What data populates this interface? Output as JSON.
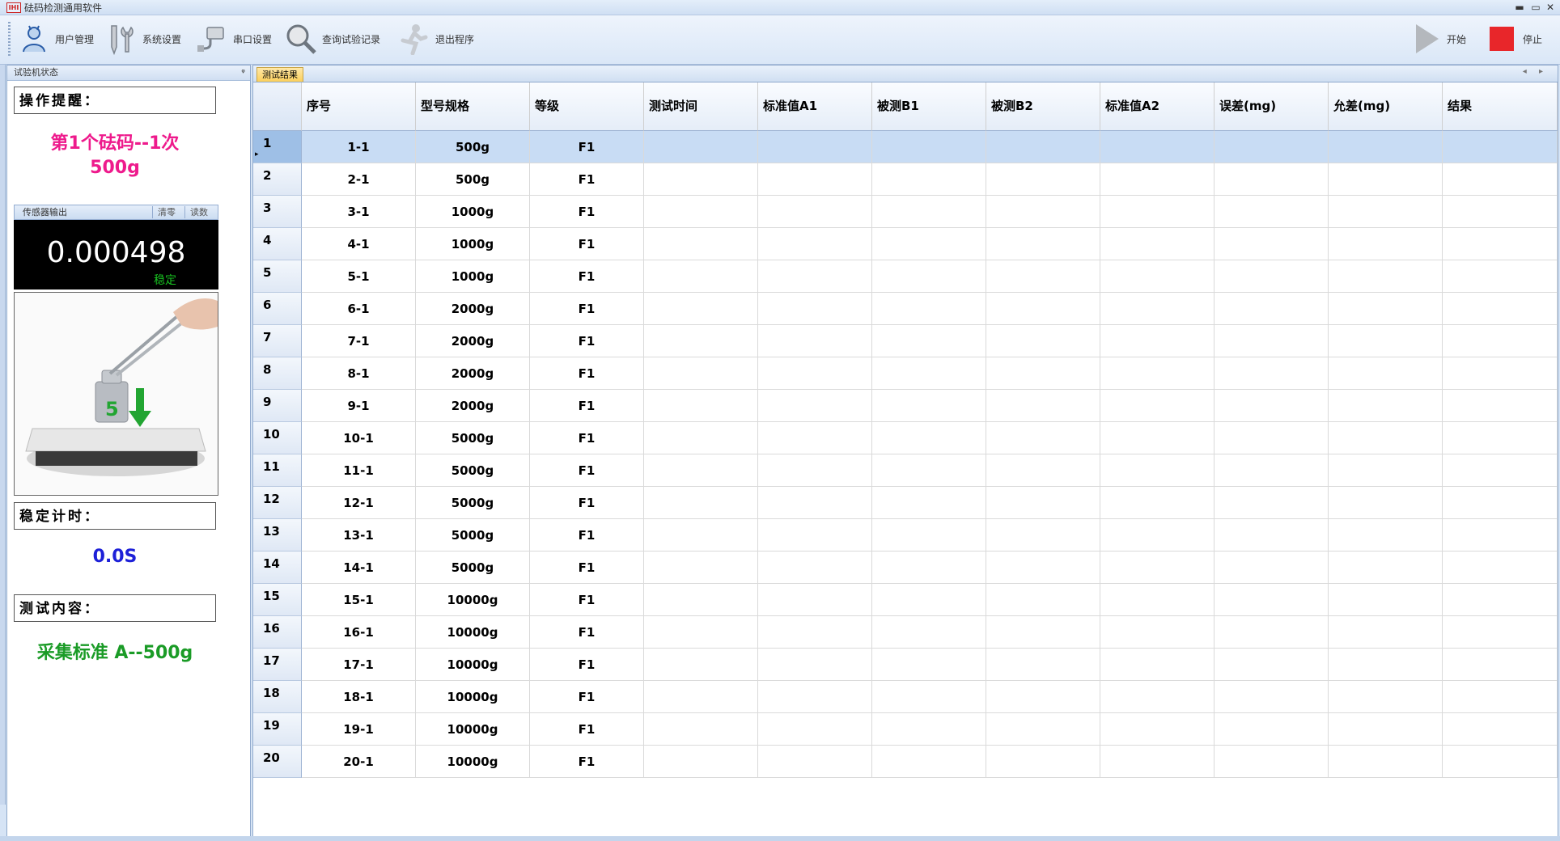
{
  "window": {
    "title": "砝码检测通用软件",
    "logo_text": "IHI",
    "minimize": "▬",
    "maximize": "▭",
    "close": "✕"
  },
  "toolbar": {
    "user_mgmt": "用户管理",
    "system_settings": "系统设置",
    "serial_settings": "串口设置",
    "query_records": "查询试验记录",
    "exit": "退出程序",
    "start": "开始",
    "stop": "停止"
  },
  "left_panel": {
    "title": "试验机状态",
    "pin": "ᵠ",
    "op_prompt_label": "操作提醒：",
    "op_prompt_line1": "第1个砝码--1次",
    "op_prompt_line2": "500g",
    "sensor_title": "传感器输出",
    "zero_button": "清零",
    "read_button": "读数",
    "sensor_value": "0.000498",
    "sensor_status": "稳定",
    "photo_mark": "5",
    "stable_timer_label": "稳定计时：",
    "stable_timer_value": "0.0S",
    "test_content_label": "测试内容：",
    "test_content_value": "采集标准 A--500g"
  },
  "colors": {
    "prompt": "#ee1a8c",
    "timer": "#1d20d8",
    "content": "#1a9b26",
    "stop": "#e8262a",
    "selected_row": "#c8dcf4"
  },
  "tab": {
    "label": "测试结果",
    "arrows": "◂ ▸"
  },
  "table": {
    "columns": [
      "序号",
      "型号规格",
      "等级",
      "测试时间",
      "标准值A1",
      "被测B1",
      "被测B2",
      "标准值A2",
      "误差(mg)",
      "允差(mg)",
      "结果"
    ],
    "selected_index": 0,
    "rows": [
      {
        "n": "1",
        "seq": "1-1",
        "spec": "500g",
        "grade": "F1"
      },
      {
        "n": "2",
        "seq": "2-1",
        "spec": "500g",
        "grade": "F1"
      },
      {
        "n": "3",
        "seq": "3-1",
        "spec": "1000g",
        "grade": "F1"
      },
      {
        "n": "4",
        "seq": "4-1",
        "spec": "1000g",
        "grade": "F1"
      },
      {
        "n": "5",
        "seq": "5-1",
        "spec": "1000g",
        "grade": "F1"
      },
      {
        "n": "6",
        "seq": "6-1",
        "spec": "2000g",
        "grade": "F1"
      },
      {
        "n": "7",
        "seq": "7-1",
        "spec": "2000g",
        "grade": "F1"
      },
      {
        "n": "8",
        "seq": "8-1",
        "spec": "2000g",
        "grade": "F1"
      },
      {
        "n": "9",
        "seq": "9-1",
        "spec": "2000g",
        "grade": "F1"
      },
      {
        "n": "10",
        "seq": "10-1",
        "spec": "5000g",
        "grade": "F1"
      },
      {
        "n": "11",
        "seq": "11-1",
        "spec": "5000g",
        "grade": "F1"
      },
      {
        "n": "12",
        "seq": "12-1",
        "spec": "5000g",
        "grade": "F1"
      },
      {
        "n": "13",
        "seq": "13-1",
        "spec": "5000g",
        "grade": "F1"
      },
      {
        "n": "14",
        "seq": "14-1",
        "spec": "5000g",
        "grade": "F1"
      },
      {
        "n": "15",
        "seq": "15-1",
        "spec": "10000g",
        "grade": "F1"
      },
      {
        "n": "16",
        "seq": "16-1",
        "spec": "10000g",
        "grade": "F1"
      },
      {
        "n": "17",
        "seq": "17-1",
        "spec": "10000g",
        "grade": "F1"
      },
      {
        "n": "18",
        "seq": "18-1",
        "spec": "10000g",
        "grade": "F1"
      },
      {
        "n": "19",
        "seq": "19-1",
        "spec": "10000g",
        "grade": "F1"
      },
      {
        "n": "20",
        "seq": "20-1",
        "spec": "10000g",
        "grade": "F1"
      }
    ]
  }
}
